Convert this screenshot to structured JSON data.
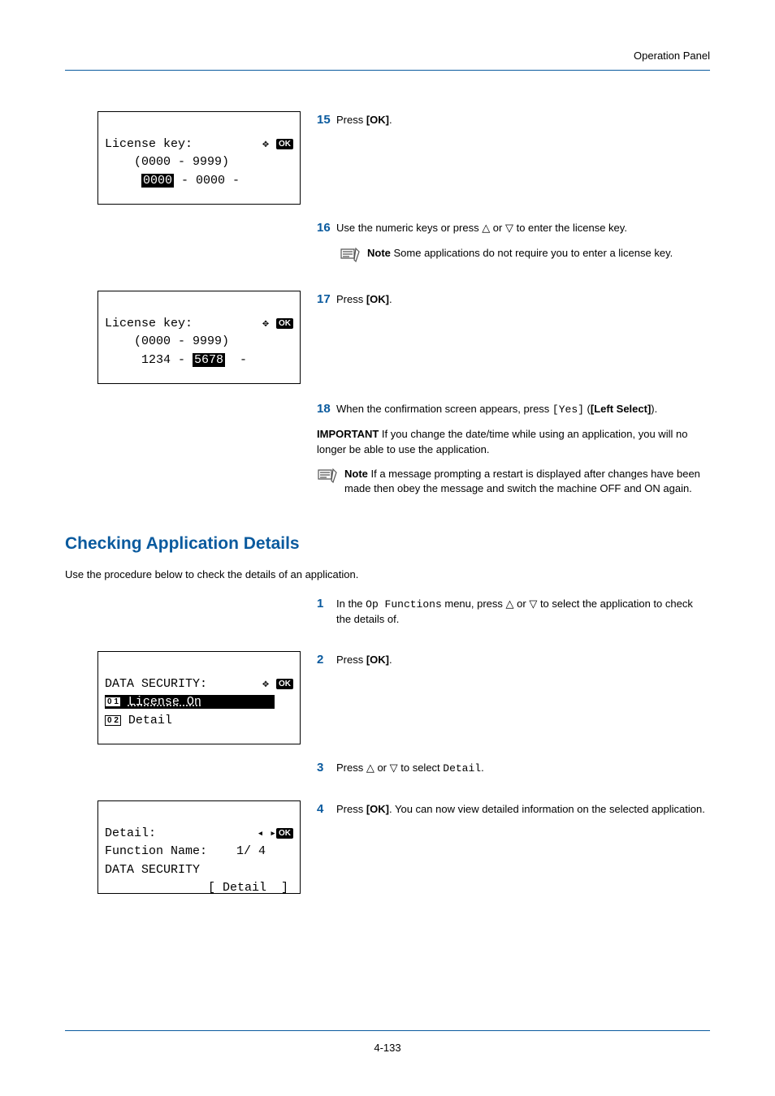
{
  "header": {
    "running": "Operation Panel"
  },
  "lcd1": {
    "title": "License key:",
    "range": "(0000 - 9999)",
    "seg1": "0000",
    "sep": " - 0000 -"
  },
  "lcd2": {
    "title": "License key:",
    "range": "(0000 - 9999)",
    "pre": "1234 - ",
    "seg": "5678",
    "post": "  -"
  },
  "lcd3": {
    "title": "DATA SECURITY:",
    "opt1": "License On",
    "opt2": "Detail"
  },
  "lcd4": {
    "title": "Detail:",
    "line2a": "Function Name:",
    "line2b": "1/ 4",
    "line3": "DATA SECURITY",
    "soft": "[ Detail  ]"
  },
  "steps": {
    "s15": {
      "num": "15",
      "text_a": "Press ",
      "text_b": "[OK]",
      "text_c": "."
    },
    "s16": {
      "num": "16",
      "text_a": "Use the numeric keys or press ",
      "text_b": " or ",
      "text_c": " to enter the license key."
    },
    "note16": {
      "label": "Note",
      "text": "  Some applications do not require you to enter a license key."
    },
    "s17": {
      "num": "17",
      "text_a": "Press ",
      "text_b": "[OK]",
      "text_c": "."
    },
    "s18": {
      "num": "18",
      "text_a": "When the confirmation screen appears, press ",
      "mono": "[Yes]",
      "text_b": " (",
      "bold": "[Left Select]",
      "text_c": ")."
    },
    "important": {
      "label": "IMPORTANT",
      "text": "  If you change the date/time while using an application, you will no longer be able to use the application."
    },
    "noteRestart": {
      "label": "Note",
      "text": "  If a message prompting a restart is displayed after changes have been made then obey the message and switch the machine OFF and ON again."
    }
  },
  "section": {
    "title": "Checking Application Details",
    "intro": "Use the procedure below to check the details of an application."
  },
  "steps2": {
    "s1": {
      "num": "1",
      "text_a": "In the ",
      "mono": "Op Functions",
      "text_b": " menu, press ",
      "text_c": " or ",
      "text_d": " to select the application to check the details of."
    },
    "s2": {
      "num": "2",
      "text_a": "Press ",
      "text_b": "[OK]",
      "text_c": "."
    },
    "s3": {
      "num": "3",
      "text_a": "Press ",
      "text_b": " or ",
      "text_c": " to select ",
      "mono": "Detail",
      "text_d": "."
    },
    "s4": {
      "num": "4",
      "text_a": "Press ",
      "bold": "[OK]",
      "text_b": ". You can now view detailed information on the selected application."
    }
  },
  "footer": {
    "page": "4-133"
  }
}
